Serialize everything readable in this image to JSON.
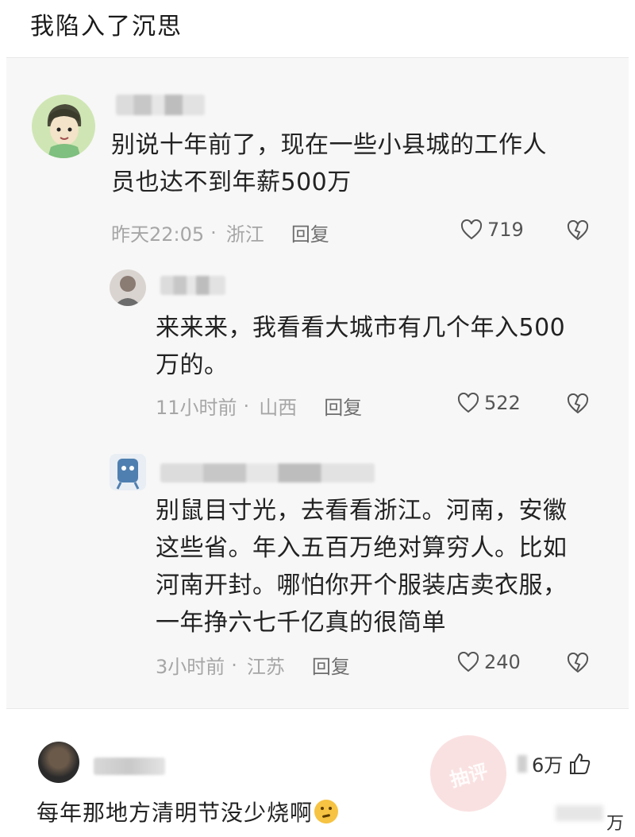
{
  "post": {
    "title": "我陷入了沉思"
  },
  "comments": [
    {
      "text_lines": [
        "别说十年前了，现在一些小县城的工作人",
        "员也达不到年薪500万"
      ],
      "time": "昨天22:05",
      "location": "浙江",
      "reply_label": "回复",
      "likes": "719"
    },
    {
      "text_lines": [
        "来来来，我看看大城市有几个年入500",
        "万的。"
      ],
      "time": "11小时前",
      "location": "山西",
      "reply_label": "回复",
      "likes": "522"
    },
    {
      "text_lines": [
        "别鼠目寸光，去看看浙江。河南，安徽",
        "这些省。年入五百万绝对算穷人。比如",
        "河南开封。哪怕你开个服装店卖衣服，",
        "一年挣六七千亿真的很简单"
      ],
      "time": "3小时前",
      "location": "江苏",
      "reply_label": "回复",
      "likes": "240"
    }
  ],
  "bottom_comment": {
    "text": "每年那地方清明节没少烧啊",
    "likes_suffix": "6万",
    "likes_suffix2": "万",
    "emoji": "thinking-face"
  },
  "watermark": {
    "text": "抽评"
  },
  "colors": {
    "like_icon": "#555555",
    "meta": "#a6a6a6",
    "reply": "#6e6e6e"
  }
}
